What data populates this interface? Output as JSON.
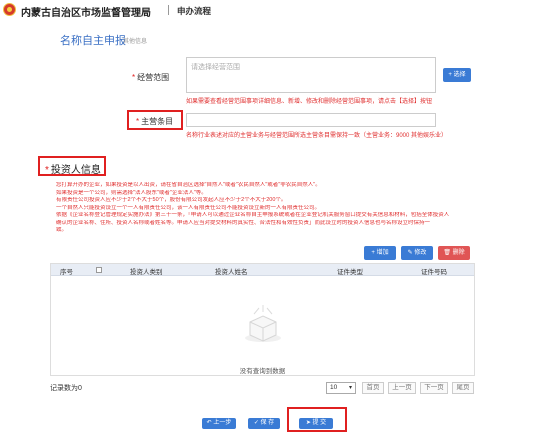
{
  "header": {
    "org_name": "内蒙古自治区市场监督管理局",
    "flow_name": "申办流程"
  },
  "section": {
    "title": "名称自主申报",
    "subtitle": "其他信息"
  },
  "form": {
    "scope_label": "经营范围",
    "scope_placeholder": "请选择经营范围",
    "select_button": "+ 选择",
    "scope_hint": "如果需要查看经营范围事项详细信息、新增、修改和删除经营范围事项，请点击【选择】按钮",
    "main_item_label": "主营条目",
    "main_item_value": "",
    "main_item_hint": "名称行业表述对应的主营业务与经营范围所选主营条目需保持一致（主营业务：9000 其他娱乐业）"
  },
  "investor": {
    "title": "投资人信息",
    "notes": [
      "您打算开办的企业，如果投资是以人出资，请在省自治区选择\"自然人\"或者\"农民自然人\"或者\"非农民自然人\"。",
      "如果投资是一个公司，则需选择\"法人股东\"或者\"企业法人\"等。",
      "有限责任公司投资人应不少于2个不大于50个，股份有限公司发起人应不少于2个不大于200个。",
      "一个自然人只能投资设立一个一人有限责任公司，该一人有限责任公司不能投资设立新的一人有限责任公司。",
      "依据《企业名称登记管理规定实施办法》第三十一条，「申请人可以通过企业名称自主申报系统或者在企业登记机关服务窗口提交有关信息和材料，包括全体投资人",
      "确认的企业名称、住所、投资人名称或者姓名等。申请人应当对提交材料的真实性、合法性和有效性负责」而此设立时的投资人信息也与名称设立时保持一",
      "致。"
    ],
    "add_button": "+ 增加",
    "edit_button": "修改",
    "delete_button": "删除",
    "columns": [
      "序号",
      "投资人类别",
      "投资人姓名",
      "证件类型",
      "证件号码"
    ],
    "empty_text": "没有查询到数据",
    "record_count": "记录数为0",
    "page_size": "10",
    "pager": [
      "首页",
      "上一页",
      "下一页",
      "尾页"
    ]
  },
  "footer": {
    "prev_button": "上一步",
    "save_button": "保 存",
    "submit_button": "提 交"
  },
  "colors": {
    "accent_blue": "#3a7bd5",
    "highlight_red": "#e02020",
    "hint_red": "#e03030",
    "delete_red": "#e05555"
  }
}
